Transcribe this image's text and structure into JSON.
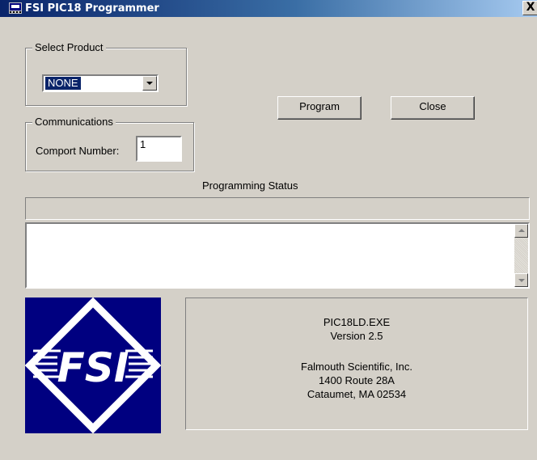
{
  "window": {
    "title": "FSI PIC18 Programmer",
    "close_label": "X"
  },
  "select_product": {
    "legend": "Select Product",
    "value": "NONE"
  },
  "communications": {
    "legend": "Communications",
    "comport_label": "Comport Number:",
    "comport_value": "1"
  },
  "buttons": {
    "program": "Program",
    "close": "Close"
  },
  "status": {
    "heading": "Programming Status",
    "text": ""
  },
  "logo": {
    "text": "FSI",
    "icon": "fsi-logo"
  },
  "info": {
    "exe": "PIC18LD.EXE",
    "version": "Version 2.5",
    "company": "Falmouth Scientific, Inc.",
    "street": "1400 Route 28A",
    "city": "Cataumet, MA 02534"
  },
  "colors": {
    "title_bar": "#0a246a",
    "logo_background": "#000080",
    "window_face": "#d4d0c8"
  }
}
